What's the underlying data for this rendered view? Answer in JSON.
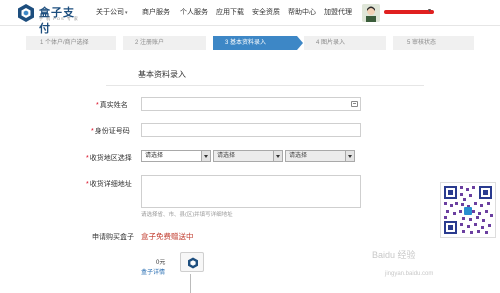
{
  "brand": {
    "name": "盒子支付",
    "tagline": "手 机 POS 专 家"
  },
  "nav": {
    "items": [
      {
        "label": "关于公司",
        "caret": "▾"
      },
      {
        "label": "商户服务"
      },
      {
        "label": "个人服务"
      },
      {
        "label": "应用下载"
      },
      {
        "label": "安全资质"
      },
      {
        "label": "帮助中心"
      },
      {
        "label": "加盟代理"
      }
    ],
    "user_caret": "▾"
  },
  "steps": [
    {
      "label": "1 个体户/商户选择",
      "active": false
    },
    {
      "label": "2 注册账户",
      "active": false
    },
    {
      "label": "3 基本资料录入",
      "active": true
    },
    {
      "label": "4 图片录入",
      "active": false
    },
    {
      "label": "5 审核状态",
      "active": false
    }
  ],
  "form": {
    "title": "基本资料录入",
    "required_mark": "*",
    "fields": {
      "name_label": "真实姓名",
      "id_label": "身份证号码",
      "region_label": "收货地区选择",
      "address_label": "收货详细地址"
    },
    "region_selects": [
      "请选择",
      "请选择",
      "请选择"
    ],
    "address_hint": "请选择省、市、县(区)并填写详细地址",
    "apply_label": "申请购买盒子",
    "apply_value": "盒子免费赠送中",
    "price": "0元",
    "detail_link": "盒子详情"
  },
  "watermark": {
    "main": "Baidu 经验",
    "sub": "jingyan.baidu.com"
  },
  "colors": {
    "accent": "#3d87c6",
    "brand": "#1d4e7e",
    "free": "#c0392b",
    "required": "#d9001b"
  }
}
